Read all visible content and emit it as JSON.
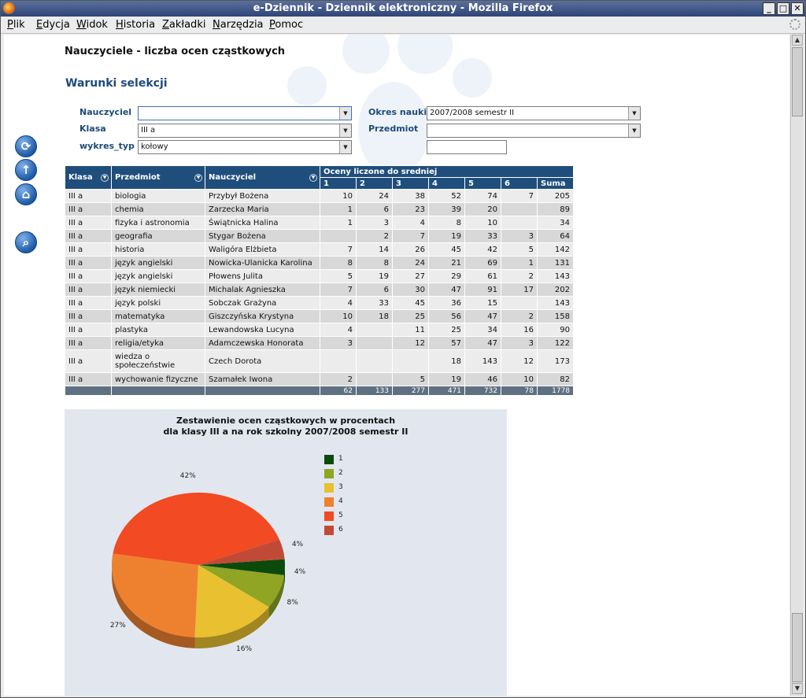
{
  "window": {
    "title": "e-Dziennik - Dziennik elektroniczny - Mozilla Firefox",
    "controls": [
      "_",
      "□",
      "✕"
    ]
  },
  "menu": [
    {
      "u": "P",
      "rest": "lik"
    },
    {
      "u": "E",
      "rest": "dycja"
    },
    {
      "u": "W",
      "rest": "idok"
    },
    {
      "u": "H",
      "rest": "istoria"
    },
    {
      "u": "Z",
      "rest": "akładki"
    },
    {
      "u": "N",
      "rest": "arzędzia"
    },
    {
      "u": "P",
      "rest": "omoc"
    }
  ],
  "page": {
    "title": "Nauczyciele - liczba ocen cząstkowych",
    "section": "Warunki selekcji"
  },
  "filters": {
    "nauczyciel_label": "Nauczyciel",
    "nauczyciel_value": "",
    "klasa_label": "Klasa",
    "klasa_value": "III a",
    "wykres_label": "wykres_typ",
    "wykres_value": "kołowy",
    "okres_label": "Okres nauki",
    "okres_value": "2007/2008 semestr II",
    "przedmiot_label": "Przedmiot",
    "przedmiot_value": "",
    "extra_value": ""
  },
  "table": {
    "headers": {
      "klasa": "Klasa",
      "przedmiot": "Przedmiot",
      "nauczyciel": "Nauczyciel",
      "group": "Oceny liczone do sredniej",
      "grades": [
        "1",
        "2",
        "3",
        "4",
        "5",
        "6"
      ],
      "suma": "Suma"
    },
    "rows": [
      {
        "klasa": "III a",
        "przedmiot": "biologia",
        "nauczyciel": "Przybył Bożena",
        "g": [
          "10",
          "24",
          "38",
          "52",
          "74",
          "7"
        ],
        "suma": "205"
      },
      {
        "klasa": "III a",
        "przedmiot": "chemia",
        "nauczyciel": "Zarzecka Maria",
        "g": [
          "1",
          "6",
          "23",
          "39",
          "20",
          ""
        ],
        "suma": "89"
      },
      {
        "klasa": "III a",
        "przedmiot": "fizyka i astronomia",
        "nauczyciel": "Świątnicka Halina",
        "g": [
          "1",
          "3",
          "4",
          "8",
          "10",
          ""
        ],
        "suma": "34"
      },
      {
        "klasa": "III a",
        "przedmiot": "geografia",
        "nauczyciel": "Stygar Bożena",
        "g": [
          "",
          "2",
          "7",
          "19",
          "33",
          "3"
        ],
        "suma": "64"
      },
      {
        "klasa": "III a",
        "przedmiot": "historia",
        "nauczyciel": "Waligóra Elżbieta",
        "g": [
          "7",
          "14",
          "26",
          "45",
          "42",
          "5"
        ],
        "suma": "142"
      },
      {
        "klasa": "III a",
        "przedmiot": "język angielski",
        "nauczyciel": "Nowicka-Ulanicka Karolina",
        "g": [
          "8",
          "8",
          "24",
          "21",
          "69",
          "1"
        ],
        "suma": "131"
      },
      {
        "klasa": "III a",
        "przedmiot": "język angielski",
        "nauczyciel": "Płowens Julita",
        "g": [
          "5",
          "19",
          "27",
          "29",
          "61",
          "2"
        ],
        "suma": "143"
      },
      {
        "klasa": "III a",
        "przedmiot": "język niemiecki",
        "nauczyciel": "Michalak Agnieszka",
        "g": [
          "7",
          "6",
          "30",
          "47",
          "91",
          "17"
        ],
        "suma": "202"
      },
      {
        "klasa": "III a",
        "przedmiot": "język polski",
        "nauczyciel": "Sobczak Grażyna",
        "g": [
          "4",
          "33",
          "45",
          "36",
          "15",
          ""
        ],
        "suma": "143"
      },
      {
        "klasa": "III a",
        "przedmiot": "matematyka",
        "nauczyciel": "Giszczyńska Krystyna",
        "g": [
          "10",
          "18",
          "25",
          "56",
          "47",
          "2"
        ],
        "suma": "158"
      },
      {
        "klasa": "III a",
        "przedmiot": "plastyka",
        "nauczyciel": "Lewandowska Lucyna",
        "g": [
          "4",
          "",
          "11",
          "25",
          "34",
          "16"
        ],
        "suma": "90"
      },
      {
        "klasa": "III a",
        "przedmiot": "religia/etyka",
        "nauczyciel": "Adamczewska Honorata",
        "g": [
          "3",
          "",
          "12",
          "57",
          "47",
          "3"
        ],
        "suma": "122"
      },
      {
        "klasa": "III a",
        "przedmiot": "wiedza o społeczeństwie",
        "nauczyciel": "Czech Dorota",
        "g": [
          "",
          "",
          "",
          "18",
          "143",
          "12"
        ],
        "suma": "173"
      },
      {
        "klasa": "III a",
        "przedmiot": "wychowanie fizyczne",
        "nauczyciel": "Szamałek Iwona",
        "g": [
          "2",
          "",
          "5",
          "19",
          "46",
          "10"
        ],
        "suma": "82"
      }
    ],
    "totals": [
      "62",
      "133",
      "277",
      "471",
      "732",
      "78",
      "1778"
    ]
  },
  "colors": {
    "header_bg": "#1f4e7c",
    "g1": "#0b4a0b",
    "g2": "#8fa523",
    "g3": "#e8c030",
    "g4": "#ee8130",
    "g5": "#f24a22",
    "g6": "#c14a36"
  },
  "icons": [
    "refresh-icon",
    "up-arrow-icon",
    "home-icon",
    "search-report-icon"
  ],
  "chart_data": {
    "type": "pie",
    "title": "Zestawienie ocen cząstkowych w procentach",
    "subtitle": "dla klasy III a  na rok szkolny 2007/2008 semestr II",
    "categories": [
      "1",
      "2",
      "3",
      "4",
      "5",
      "6"
    ],
    "values": [
      62,
      133,
      277,
      471,
      732,
      78
    ],
    "labels": [
      "4%",
      "8%",
      "16%",
      "27%",
      "42%",
      "4%"
    ],
    "legend": "right"
  }
}
